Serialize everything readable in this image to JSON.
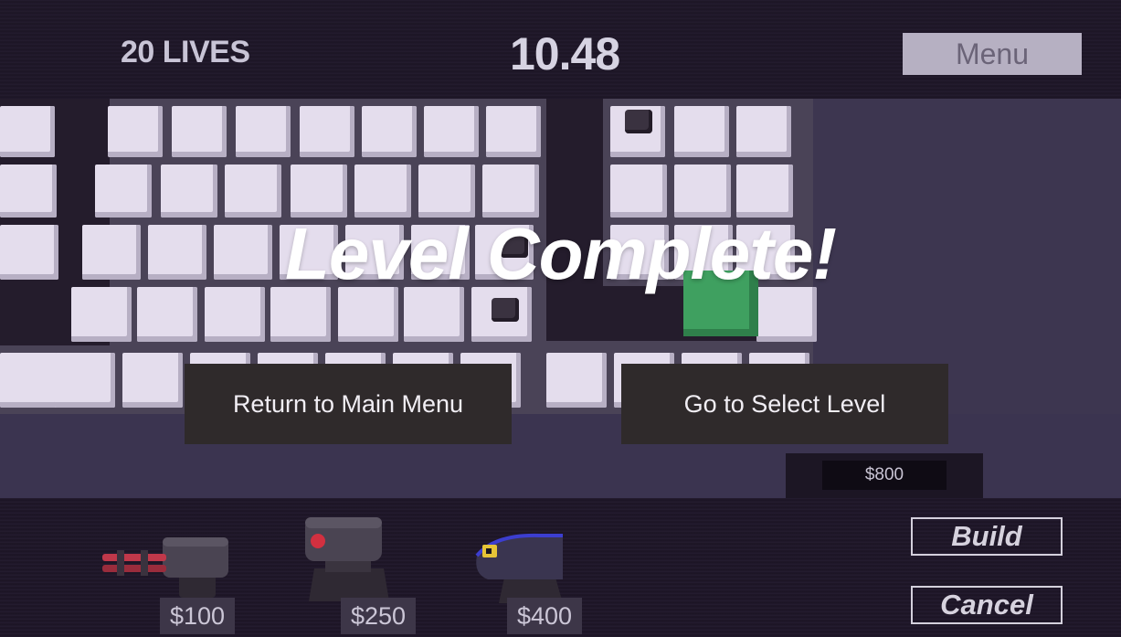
{
  "hud": {
    "lives": "20 LIVES",
    "timer": "10.48",
    "menu_label": "Menu"
  },
  "overlay": {
    "title": "Level Complete!",
    "main_menu_label": "Return to Main Menu",
    "select_level_label": "Go to Select Level"
  },
  "money": {
    "amount": "$800"
  },
  "shop": {
    "turrets": [
      {
        "name": "red-barrel-turret",
        "price": "$100",
        "accent": "#c0384a"
      },
      {
        "name": "red-eye-cannon-turret",
        "price": "$250",
        "accent": "#d23040"
      },
      {
        "name": "blue-laser-turret",
        "price": "$400",
        "accent": "#e6c437"
      }
    ]
  },
  "actions": {
    "build_label": "Build",
    "cancel_label": "Cancel"
  },
  "colors": {
    "enemy": "#3fa060",
    "tile": "#e4dded",
    "path": "#241c2c"
  }
}
